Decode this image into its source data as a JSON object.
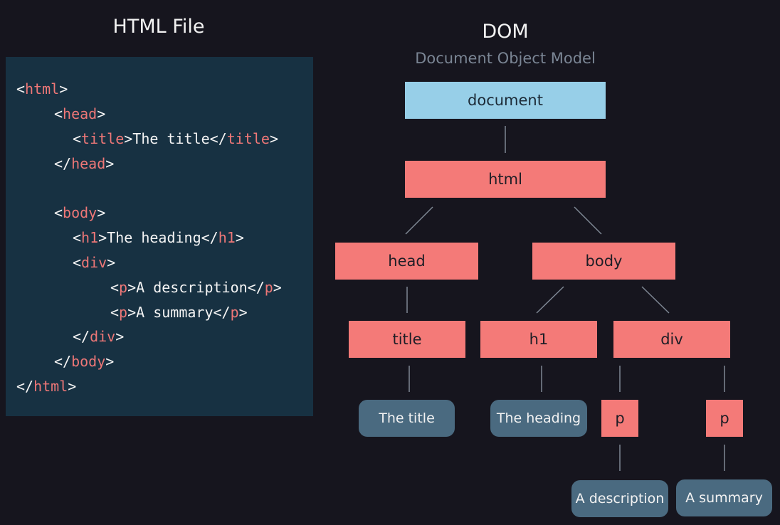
{
  "left": {
    "title": "HTML File",
    "code": [
      [
        [
          "p",
          "<"
        ],
        [
          "t",
          "html"
        ],
        [
          "p",
          ">"
        ]
      ],
      [
        [
          "p",
          "<"
        ],
        [
          "t",
          "head"
        ],
        [
          "p",
          ">"
        ]
      ],
      [
        [
          "p",
          "<"
        ],
        [
          "t",
          "title"
        ],
        [
          "p",
          ">The title</"
        ],
        [
          "t",
          "title"
        ],
        [
          "p",
          ">"
        ]
      ],
      [
        [
          "p",
          "</"
        ],
        [
          "t",
          "head"
        ],
        [
          "p",
          ">"
        ]
      ],
      [
        [
          "p",
          "<"
        ],
        [
          "t",
          "body"
        ],
        [
          "p",
          ">"
        ]
      ],
      [
        [
          "p",
          "<"
        ],
        [
          "t",
          "h1"
        ],
        [
          "p",
          ">The heading</"
        ],
        [
          "t",
          "h1"
        ],
        [
          "p",
          ">"
        ]
      ],
      [
        [
          "p",
          "<"
        ],
        [
          "t",
          "div"
        ],
        [
          "p",
          ">"
        ]
      ],
      [
        [
          "p",
          "<"
        ],
        [
          "t",
          "p"
        ],
        [
          "p",
          ">A description</"
        ],
        [
          "t",
          "p"
        ],
        [
          "p",
          ">"
        ]
      ],
      [
        [
          "p",
          "<"
        ],
        [
          "t",
          "p"
        ],
        [
          "p",
          ">A summary</"
        ],
        [
          "t",
          "p"
        ],
        [
          "p",
          ">"
        ]
      ],
      [
        [
          "p",
          "</"
        ],
        [
          "t",
          "div"
        ],
        [
          "p",
          ">"
        ]
      ],
      [
        [
          "p",
          "</"
        ],
        [
          "t",
          "body"
        ],
        [
          "p",
          ">"
        ]
      ],
      [
        [
          "p",
          "</"
        ],
        [
          "t",
          "html"
        ],
        [
          "p",
          ">"
        ]
      ]
    ]
  },
  "right": {
    "title": "DOM",
    "subtitle": "Document Object Model"
  },
  "tree": {
    "document": "document",
    "html": "html",
    "head": "head",
    "body": "body",
    "title": "title",
    "h1": "h1",
    "div": "div",
    "p1": "p",
    "p2": "p",
    "text_title": "The title",
    "text_heading": "The heading",
    "text_description": "A description",
    "text_summary": "A summary"
  },
  "colors": {
    "background": "#16151e",
    "code_panel": "#173142",
    "code_tag": "#ee7777",
    "root_node": "#97cfe8",
    "element_node": "#f47a78",
    "text_node": "#4a6a80",
    "connector": "#7e8794"
  }
}
